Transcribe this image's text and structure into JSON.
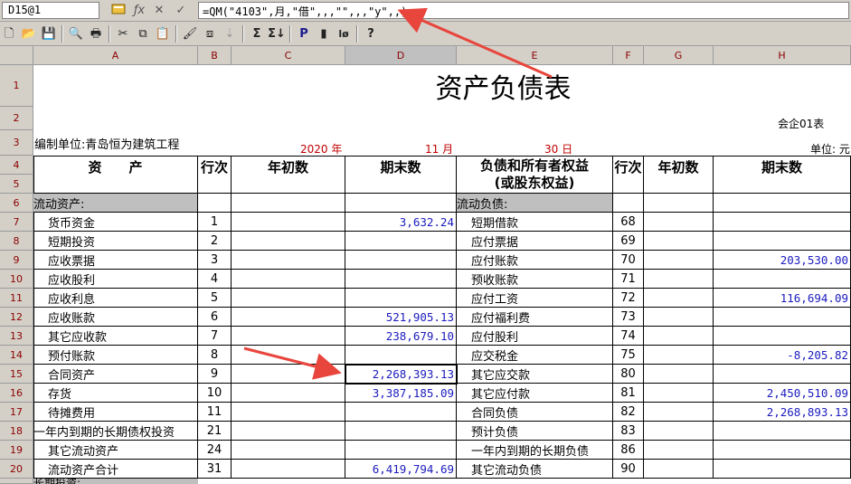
{
  "name_box": "D15@1",
  "formula": "=QM(\"4103\",月,\"借\",,,\"\",,,\"y\",,)",
  "icons": [
    "calc-icon",
    "fx-icon",
    "cancel-icon",
    "confirm-icon"
  ],
  "columns": [
    "A",
    "B",
    "C",
    "D",
    "E",
    "F",
    "G",
    "H"
  ],
  "rows": [
    "1",
    "2",
    "3",
    "4",
    "5",
    "6",
    "7",
    "8",
    "9",
    "10",
    "11",
    "12",
    "13",
    "14",
    "15",
    "16",
    "17",
    "18",
    "19",
    "20",
    ""
  ],
  "report": {
    "title": "资产负债表",
    "form_code": "会企01表",
    "unit_label": "编制单位:青岛恒为建筑工程",
    "year": "2020 年",
    "month": "11 月",
    "day": "30 日",
    "currency": "单位: 元"
  },
  "headers": {
    "asset": "资　　产",
    "line": "行次",
    "begin": "年初数",
    "end": "期末数",
    "liab_line1": "负债和所有者权益",
    "liab_line2": "(或股东权益)",
    "line2": "行次",
    "begin2": "年初数",
    "end2": "期末数"
  },
  "section_left": "流动资产:",
  "section_right": "流动负债:",
  "table_rows": [
    {
      "asset": "货币资金",
      "line": "1",
      "end": "3,632.24",
      "liab": "短期借款",
      "line2": "68",
      "end2": ""
    },
    {
      "asset": "短期投资",
      "line": "2",
      "end": "",
      "liab": "应付票据",
      "line2": "69",
      "end2": ""
    },
    {
      "asset": "应收票据",
      "line": "3",
      "end": "",
      "liab": "应付账款",
      "line2": "70",
      "end2": "203,530.00"
    },
    {
      "asset": "应收股利",
      "line": "4",
      "end": "",
      "liab": "预收账款",
      "line2": "71",
      "end2": ""
    },
    {
      "asset": "应收利息",
      "line": "5",
      "end": "",
      "liab": "应付工资",
      "line2": "72",
      "end2": "116,694.09"
    },
    {
      "asset": "应收账款",
      "line": "6",
      "end": "521,905.13",
      "liab": "应付福利费",
      "line2": "73",
      "end2": ""
    },
    {
      "asset": "其它应收款",
      "line": "7",
      "end": "238,679.10",
      "liab": "应付股利",
      "line2": "74",
      "end2": ""
    },
    {
      "asset": "预付账款",
      "line": "8",
      "end": "",
      "liab": "应交税金",
      "line2": "75",
      "end2": "-8,205.82"
    },
    {
      "asset": "合同资产",
      "line": "9",
      "end": "2,268,393.13",
      "liab": "其它应交款",
      "line2": "80",
      "end2": ""
    },
    {
      "asset": "存货",
      "line": "10",
      "end": "3,387,185.09",
      "liab": "其它应付款",
      "line2": "81",
      "end2": "2,450,510.09"
    },
    {
      "asset": "待摊费用",
      "line": "11",
      "end": "",
      "liab": "合同负债",
      "line2": "82",
      "end2": "2,268,893.13"
    },
    {
      "asset": "一年内到期的长期债权投资",
      "line": "21",
      "end": "",
      "liab": "预计负债",
      "line2": "83",
      "end2": ""
    },
    {
      "asset": "其它流动资产",
      "line": "24",
      "end": "",
      "liab": "一年内到期的长期负债",
      "line2": "86",
      "end2": ""
    },
    {
      "asset": "流动资产合计",
      "line": "31",
      "end": "6,419,794.69",
      "liab": "其它流动负债",
      "line2": "90",
      "end2": ""
    }
  ],
  "last_row_partial": "长期投资:",
  "colors": {
    "accent_arrow": "#e8453c",
    "value_blue": "#1b1bbf",
    "date_red": "#c00000",
    "section_gray": "#bfbfbf"
  }
}
